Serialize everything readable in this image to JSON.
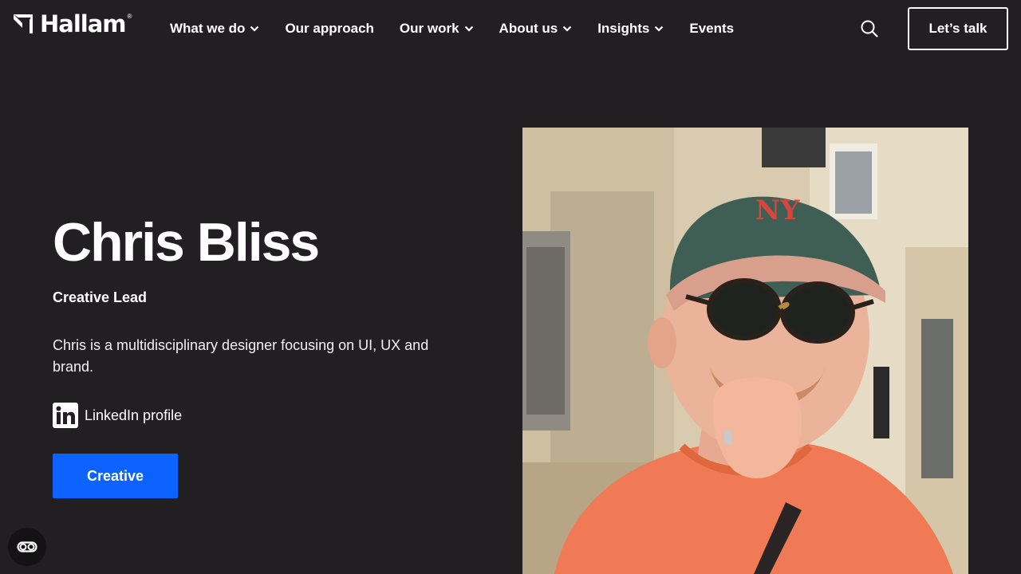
{
  "header": {
    "logo_text": "Hallam",
    "logo_reg": "®",
    "nav": [
      {
        "label": "What we do",
        "dropdown": true
      },
      {
        "label": "Our approach",
        "dropdown": false
      },
      {
        "label": "Our work",
        "dropdown": true
      },
      {
        "label": "About us",
        "dropdown": true
      },
      {
        "label": "Insights",
        "dropdown": true
      },
      {
        "label": "Events",
        "dropdown": false
      }
    ],
    "search_icon": "search-icon",
    "cta_label": "Let’s talk"
  },
  "profile": {
    "name": "Chris Bliss",
    "role": "Creative Lead",
    "bio": "Chris is a multidisciplinary designer focusing on UI, UX and brand.",
    "linkedin_label": "LinkedIn profile",
    "tag_label": "Creative"
  },
  "photo": {
    "icon": "portrait-photo"
  },
  "accessibility": {
    "icon": "accessibility-toggle-icon"
  },
  "colors": {
    "background": "#221f23",
    "accent": "#0c63ff",
    "text": "#ffffff"
  }
}
